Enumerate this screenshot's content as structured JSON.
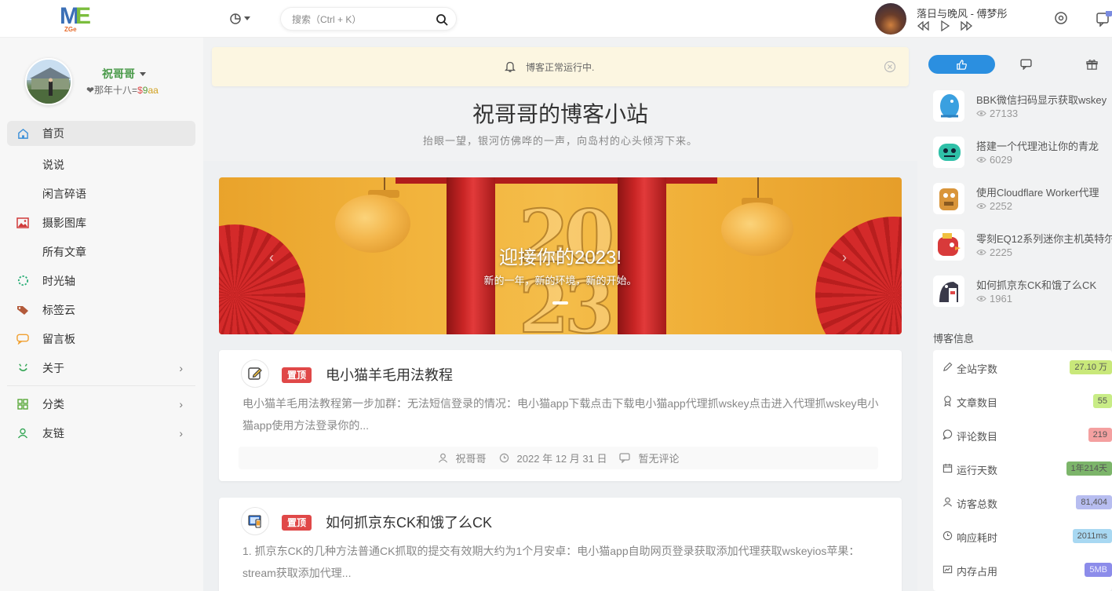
{
  "header": {
    "logo_text": "ME",
    "logo_sub": "ZGe",
    "search_placeholder": "搜索（Ctrl + K）",
    "player": {
      "track": "落日与晚风 - 傅梦彤"
    }
  },
  "profile": {
    "name": "祝哥哥",
    "motto_prefix": "❤那年十八=",
    "motto_c1": "$",
    "motto_c2": "9",
    "motto_c3": "aa"
  },
  "nav": {
    "items": [
      {
        "label": "首页",
        "icon": "home-icon",
        "active": true
      },
      {
        "label": "说说",
        "icon": ""
      },
      {
        "label": "闲言碎语",
        "icon": ""
      },
      {
        "label": "摄影图库",
        "icon": "image-icon"
      },
      {
        "label": "所有文章",
        "icon": ""
      },
      {
        "label": "时光轴",
        "icon": "timeline-icon"
      },
      {
        "label": "标签云",
        "icon": "tag-icon"
      },
      {
        "label": "留言板",
        "icon": "message-icon"
      },
      {
        "label": "关于",
        "icon": "about-icon",
        "arrow": "›"
      }
    ],
    "items2": [
      {
        "label": "分类",
        "icon": "category-icon",
        "arrow": "›"
      },
      {
        "label": "友链",
        "icon": "friends-icon",
        "arrow": "›"
      }
    ]
  },
  "notice": {
    "text": "博客正常运行中."
  },
  "site": {
    "title": "祝哥哥的博客小站",
    "subtitle": "抬眼一望，银河仿佛哗的一声，向岛村的心头倾泻下来。"
  },
  "banner": {
    "title": "迎接你的2023!",
    "subtitle": "新的一年，新的环境，新的开始。",
    "big_number": "20\n23"
  },
  "posts": [
    {
      "pin": "置顶",
      "title": "电小猫羊毛用法教程",
      "excerpt": "电小猫羊毛用法教程第一步加群：无法短信登录的情况：电小猫app下载点击下载电小猫app代理抓wskey点击进入代理抓wskey电小猫app使用方法登录你的...",
      "author": "祝哥哥",
      "date": "2022 年 12 月 31 日",
      "comments": "暂无评论"
    },
    {
      "pin": "置顶",
      "title": "如何抓京东CK和饿了么CK",
      "excerpt": "1. 抓京东CK的几种方法普通CK抓取的提交有效期大约为1个月安卓：电小猫app自助网页登录获取添加代理获取wskeyios苹果：stream获取添加代理..."
    }
  ],
  "hot": [
    {
      "title": "BBK微信扫码显示获取wskey",
      "views": "27133",
      "color": "#3aa0e0"
    },
    {
      "title": "搭建一个代理池让你的青龙",
      "views": "6029",
      "color": "#2fc0a8"
    },
    {
      "title": "使用Cloudflare Worker代理",
      "views": "2252",
      "color": "#d9953a"
    },
    {
      "title": "零刻EQ12系列迷你主机英特尔",
      "views": "2225",
      "color": "#d83a3a"
    },
    {
      "title": "如何抓京东CK和饿了么CK",
      "views": "1961",
      "color": "#3a3a4a"
    }
  ],
  "blog_info": {
    "heading": "博客信息",
    "rows": [
      {
        "label": "全站字数",
        "value": "27.10 万",
        "color": "#c9e87a",
        "icon": "pen-icon"
      },
      {
        "label": "文章数目",
        "value": "55",
        "color": "#c8ec86",
        "icon": "medal-icon"
      },
      {
        "label": "评论数目",
        "value": "219",
        "color": "#f4a0a0",
        "icon": "comment-icon"
      },
      {
        "label": "运行天数",
        "value": "1年214天",
        "color": "#7cb56a",
        "icon": "calendar-icon"
      },
      {
        "label": "访客总数",
        "value": "81,404",
        "color": "#b7bdf0",
        "icon": "user-icon"
      },
      {
        "label": "响应耗时",
        "value": "2011ms",
        "color": "#a8d8f2",
        "icon": "clock-icon"
      },
      {
        "label": "内存占用",
        "value": "5MB",
        "color": "#8c8cea",
        "icon": "chip-icon"
      }
    ]
  }
}
